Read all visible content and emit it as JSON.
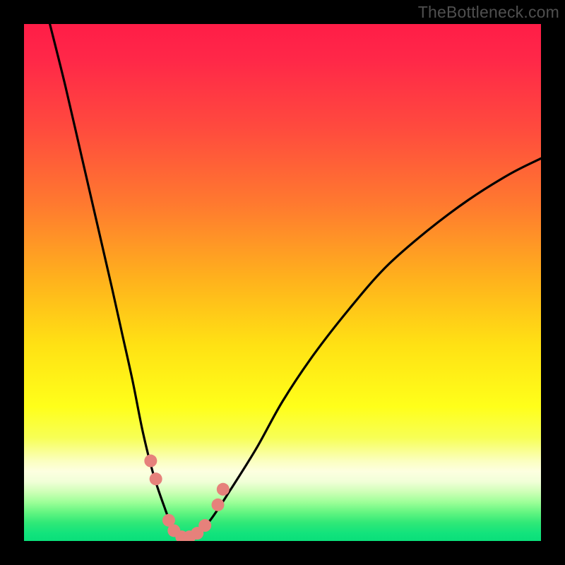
{
  "watermark": {
    "text": "TheBottleneck.com"
  },
  "colors": {
    "black": "#000000",
    "curve": "#000000",
    "dot_fill": "#e6817b",
    "gradient_stops": [
      {
        "offset": 0.0,
        "color": "#ff1d47"
      },
      {
        "offset": 0.07,
        "color": "#ff2848"
      },
      {
        "offset": 0.2,
        "color": "#ff4a3e"
      },
      {
        "offset": 0.35,
        "color": "#ff7a2f"
      },
      {
        "offset": 0.5,
        "color": "#ffb41c"
      },
      {
        "offset": 0.62,
        "color": "#ffe114"
      },
      {
        "offset": 0.74,
        "color": "#ffff1a"
      },
      {
        "offset": 0.8,
        "color": "#f7ff55"
      },
      {
        "offset": 0.845,
        "color": "#fbffbf"
      },
      {
        "offset": 0.865,
        "color": "#fdffe0"
      },
      {
        "offset": 0.885,
        "color": "#f1ffd8"
      },
      {
        "offset": 0.905,
        "color": "#ceffb7"
      },
      {
        "offset": 0.925,
        "color": "#9dff98"
      },
      {
        "offset": 0.945,
        "color": "#62f581"
      },
      {
        "offset": 0.965,
        "color": "#2fe877"
      },
      {
        "offset": 0.985,
        "color": "#12e37c"
      },
      {
        "offset": 1.0,
        "color": "#0adf7a"
      }
    ]
  },
  "chart_data": {
    "type": "line",
    "title": "",
    "xlabel": "",
    "ylabel": "",
    "x_range": [
      0,
      100
    ],
    "y_range": [
      0,
      100
    ],
    "series": [
      {
        "name": "bottleneck-curve",
        "x": [
          5,
          8,
          11,
          14,
          17,
          19,
          21,
          23,
          25,
          27,
          29,
          31,
          33,
          36,
          40,
          45,
          50,
          56,
          63,
          70,
          78,
          86,
          94,
          100
        ],
        "y": [
          100,
          88,
          75,
          62,
          49,
          40,
          31,
          21,
          13,
          7,
          2,
          0,
          1,
          4,
          10,
          18,
          27,
          36,
          45,
          53,
          60,
          66,
          71,
          74
        ]
      }
    ],
    "markers": {
      "name": "highlight-dots",
      "points": [
        {
          "x": 24.5,
          "y": 15.5
        },
        {
          "x": 25.5,
          "y": 12.0
        },
        {
          "x": 28.0,
          "y": 4.0
        },
        {
          "x": 29.0,
          "y": 2.0
        },
        {
          "x": 30.5,
          "y": 0.8
        },
        {
          "x": 32.0,
          "y": 0.8
        },
        {
          "x": 33.5,
          "y": 1.5
        },
        {
          "x": 35.0,
          "y": 3.0
        },
        {
          "x": 37.5,
          "y": 7.0
        },
        {
          "x": 38.5,
          "y": 10.0
        }
      ]
    }
  }
}
